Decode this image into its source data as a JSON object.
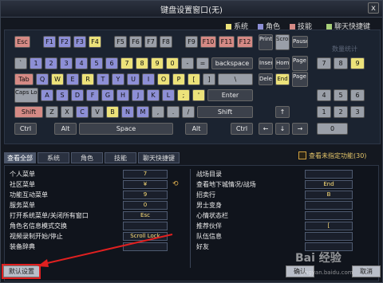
{
  "window": {
    "title": "键盘设置窗口(无)",
    "close_label": "x"
  },
  "legend": [
    {
      "label": "系统",
      "color": "#ece27a"
    },
    {
      "label": "角色",
      "color": "#8d8fd6"
    },
    {
      "label": "技能",
      "color": "#d58a85"
    },
    {
      "label": "聊天快捷键",
      "color": "#a8cf78"
    }
  ],
  "keys": {
    "esc": "Esc",
    "f1": "F1",
    "f2": "F2",
    "f3": "F3",
    "f4": "F4",
    "f5": "F5",
    "f6": "F6",
    "f7": "F7",
    "f8": "F8",
    "f9": "F9",
    "f10": "F10",
    "f11": "F11",
    "f12": "F12",
    "prtsc": "Print Scrn",
    "scrlk": "Scroll Lock",
    "pause": "Pause",
    "tilde": "`",
    "n1": "1",
    "n2": "2",
    "n3": "3",
    "n4": "4",
    "n5": "5",
    "n6": "6",
    "n7": "7",
    "n8": "8",
    "n9": "9",
    "n0": "0",
    "minus": "-",
    "equal": "=",
    "backspace": "backspace",
    "insert": "Insert",
    "home": "Home",
    "pgup": "Page Up",
    "tab": "Tab",
    "q": "Q",
    "w": "W",
    "e": "E",
    "r": "R",
    "t": "T",
    "y": "Y",
    "u": "U",
    "i": "I",
    "o": "O",
    "p": "P",
    "lbr": "[",
    "rbr": "]",
    "bslash": "\\",
    "delete": "Delete",
    "end": "End",
    "pgdn": "Page Down",
    "caps": "Caps Lock",
    "a": "A",
    "s": "S",
    "d": "D",
    "f": "F",
    "g": "G",
    "h": "H",
    "j": "J",
    "k": "K",
    "l": "L",
    "semi": ";",
    "quote": "'",
    "enter": "Enter",
    "shift": "Shift",
    "z": "Z",
    "x": "X",
    "c": "C",
    "v": "V",
    "b": "B",
    "n": "N",
    "m": "M",
    "comma": ",",
    "period": ".",
    "slash": "/",
    "rshift": "Shift",
    "ctrl": "Ctrl",
    "alt": "Alt",
    "space": "Space",
    "ralt": "Alt",
    "rctrl": "Ctrl",
    "up": "↑",
    "left": "←",
    "down": "↓",
    "right": "→",
    "np7": "7",
    "np8": "8",
    "np9": "9",
    "np4": "4",
    "np5": "5",
    "np6": "6",
    "np1": "1",
    "np2": "2",
    "np3": "3",
    "np0": "0"
  },
  "faint_label": "数量统计",
  "tabs": [
    "查看全部",
    "系统",
    "角色",
    "技能",
    "聊天快捷键"
  ],
  "unassigned_checkbox_label": "查看未指定功能(30)",
  "left_list": [
    {
      "label": "个人菜单",
      "value": "7"
    },
    {
      "label": "社区菜单",
      "value": "¥"
    },
    {
      "label": "功能互动菜单",
      "value": "9"
    },
    {
      "label": "服务菜单",
      "value": "0"
    },
    {
      "label": "打开系统菜单/关闭所有窗口",
      "value": "Esc"
    },
    {
      "label": "角色名信息模式交换",
      "value": ""
    },
    {
      "label": "视频录制开始/停止",
      "value": "Scroll Lock"
    },
    {
      "label": "装备辞典",
      "value": ""
    }
  ],
  "right_list": [
    {
      "label": "战场目录",
      "value": ""
    },
    {
      "label": "查看地下城情况/战场",
      "value": "End"
    },
    {
      "label": "招卖行",
      "value": "B"
    },
    {
      "label": "男士变身",
      "value": ""
    },
    {
      "label": "心情状态栏",
      "value": ""
    },
    {
      "label": "推荐伙伴",
      "value": "["
    },
    {
      "label": "队伍信息",
      "value": ""
    },
    {
      "label": "好友",
      "value": ""
    }
  ],
  "buttons": {
    "restore": "默认设置",
    "confirm": "确认",
    "cancel": "取消"
  },
  "watermark": {
    "brand": "Bai 经验",
    "url": "jingyan.baidu.com"
  },
  "colors": {
    "system": "#ece27a",
    "character": "#8d8fd6",
    "skill": "#d58a85",
    "chat": "#a8cf78",
    "highlight": "#e02020"
  }
}
